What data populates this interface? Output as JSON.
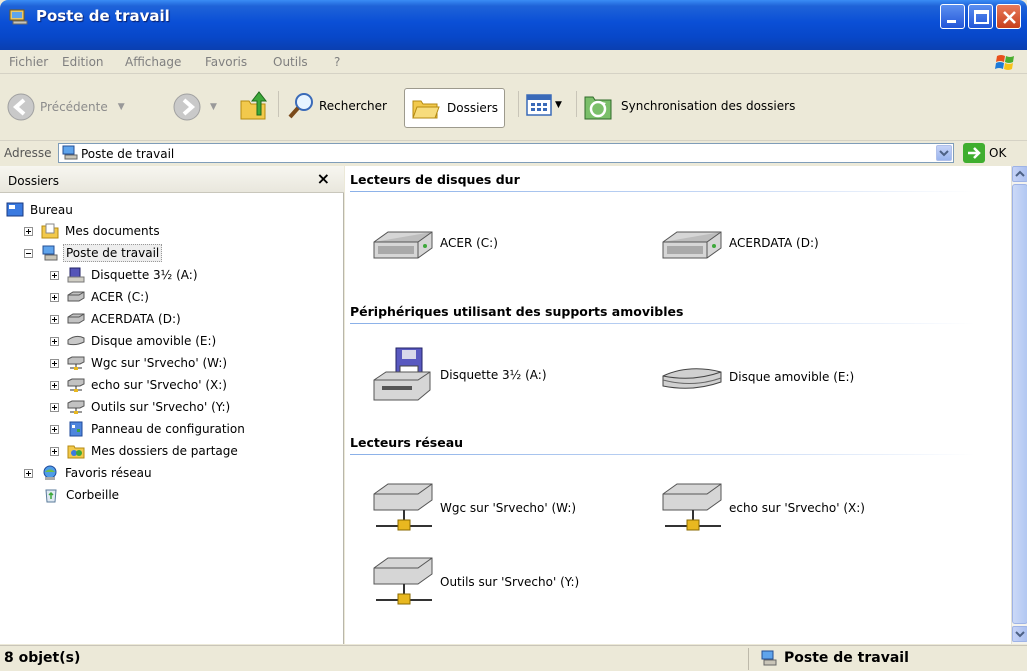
{
  "window": {
    "title": "Poste de travail",
    "icons": {
      "app": "my-computer-icon",
      "minimize": "minimize-icon",
      "maximize": "maximize-icon",
      "close": "close-icon"
    }
  },
  "menu": [
    "Fichier",
    "Edition",
    "Affichage",
    "Favoris",
    "Outils",
    "?"
  ],
  "toolbar": {
    "back": "Précédente",
    "search": "Rechercher",
    "folders": "Dossiers",
    "sync": "Synchronisation des dossiers"
  },
  "address": {
    "label": "Adresse",
    "value": "Poste de travail",
    "go": "OK"
  },
  "folders_pane": {
    "title": "Dossiers",
    "close": "×",
    "tree": [
      {
        "label": "Bureau",
        "icon": "desktop-icon"
      },
      {
        "label": "Mes documents",
        "icon": "my-documents-icon"
      },
      {
        "label": "Poste de travail",
        "icon": "my-computer-icon"
      },
      {
        "label": "Disquette 3½ (A:)",
        "icon": "floppy-icon"
      },
      {
        "label": "ACER (C:)",
        "icon": "hard-drive-icon"
      },
      {
        "label": "ACERDATA (D:)",
        "icon": "hard-drive-icon"
      },
      {
        "label": "Disque amovible (E:)",
        "icon": "removable-disk-icon"
      },
      {
        "label": "Wgc sur 'Srvecho' (W:)",
        "icon": "network-drive-icon"
      },
      {
        "label": "echo sur 'Srvecho' (X:)",
        "icon": "network-drive-icon"
      },
      {
        "label": "Outils sur 'Srvecho' (Y:)",
        "icon": "network-drive-icon"
      },
      {
        "label": "Panneau de configuration",
        "icon": "control-panel-icon"
      },
      {
        "label": "Mes dossiers de partage",
        "icon": "shared-folders-icon"
      },
      {
        "label": "Favoris réseau",
        "icon": "network-places-icon"
      },
      {
        "label": "Corbeille",
        "icon": "recycle-bin-icon"
      }
    ]
  },
  "groups": {
    "hdd": {
      "title": "Lecteurs de disques dur",
      "items": [
        "ACER (C:)",
        "ACERDATA (D:)"
      ]
    },
    "removable": {
      "title": "Périphériques utilisant des supports amovibles",
      "items": [
        "Disquette 3½ (A:)",
        "Disque amovible (E:)"
      ]
    },
    "network": {
      "title": "Lecteurs réseau",
      "items": [
        "Wgc sur 'Srvecho' (W:)",
        "echo sur 'Srvecho' (X:)",
        "Outils sur 'Srvecho' (Y:)"
      ]
    }
  },
  "status": {
    "count": "8 objet(s)",
    "location": "Poste de travail"
  },
  "colors": {
    "titlebar": "#0a4fd6",
    "selection_line": "#8ab0e8",
    "window_face": "#ece9d8"
  }
}
